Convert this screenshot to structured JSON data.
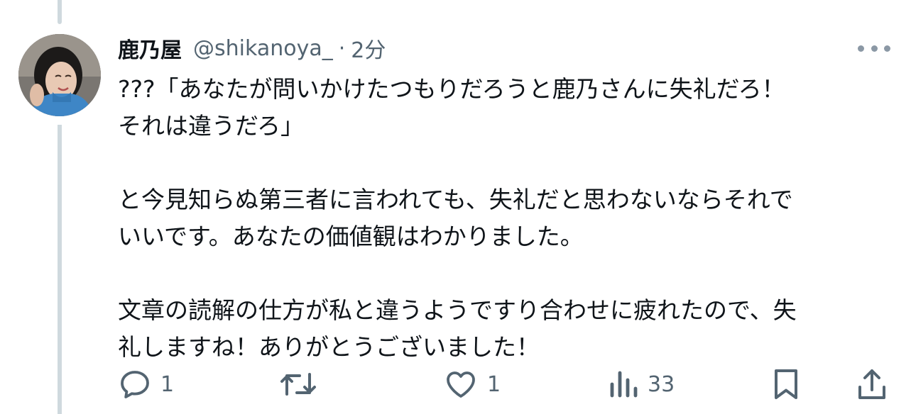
{
  "tweet": {
    "display_name": "鹿乃屋",
    "handle": "@shikanoya_",
    "separator": "·",
    "time": "2分",
    "lines": [
      "???「あなたが問いかけたつもりだろうと鹿乃さんに失礼だろ！",
      "それは違うだろ」",
      "",
      "と今見知らぬ第三者に言われても、失礼だと思わないならそれで",
      "いいです。あなたの価値観はわかりました。",
      "",
      "文章の読解の仕方が私と違うようですり合わせに疲れたので、失",
      "礼しますね！ありがとうございました！"
    ]
  },
  "actions": {
    "reply_count": "1",
    "retweet_count": "",
    "like_count": "1",
    "views_count": "33"
  },
  "icons": {
    "reply": "reply-icon",
    "retweet": "retweet-icon",
    "like": "heart-icon",
    "views": "analytics-icon",
    "bookmark": "bookmark-icon",
    "share": "share-icon",
    "more": "more-icon"
  },
  "colors": {
    "text": "#0f1419",
    "secondary": "#536471",
    "thread_line": "#cfd9de"
  }
}
